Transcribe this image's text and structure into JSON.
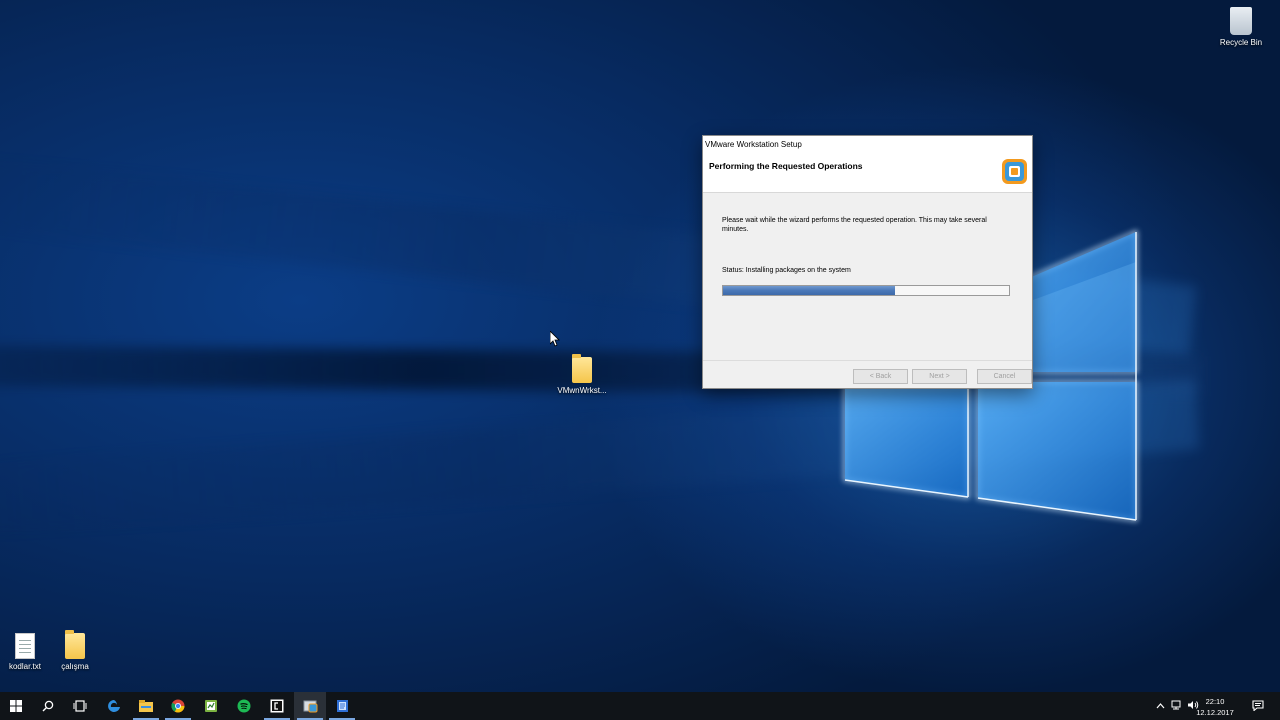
{
  "desktop": {
    "icons": {
      "recycle_bin": "Recycle Bin",
      "vmware_folder": "VMwnWrkst...",
      "kodlar": "kodlar.txt",
      "calisma": "çalışma"
    }
  },
  "setup": {
    "title": "VMware Workstation Setup",
    "heading": "Performing the Requested Operations",
    "description": "Please wait while the wizard performs the requested operation. This may take several minutes.",
    "status": "Status:  Installing packages on the system",
    "progress": 0.6,
    "buttons": {
      "back": "< Back",
      "next": "Next >",
      "cancel": "Cancel"
    }
  },
  "taskbar": {
    "apps": [
      "windows-icon",
      "search-icon",
      "task-view-icon",
      "edge-icon",
      "file-explorer-icon",
      "chrome-icon",
      "sublime-icon",
      "spotify-icon",
      "terminal-icon",
      "vmware-setup-icon",
      "notepad-icon"
    ],
    "tray": {
      "time": "22:10",
      "date": "12.12.2017"
    }
  },
  "colors": {
    "progress_fill": "#4a78b8",
    "taskbar": "#101418",
    "accent": "#7aa7e0"
  }
}
